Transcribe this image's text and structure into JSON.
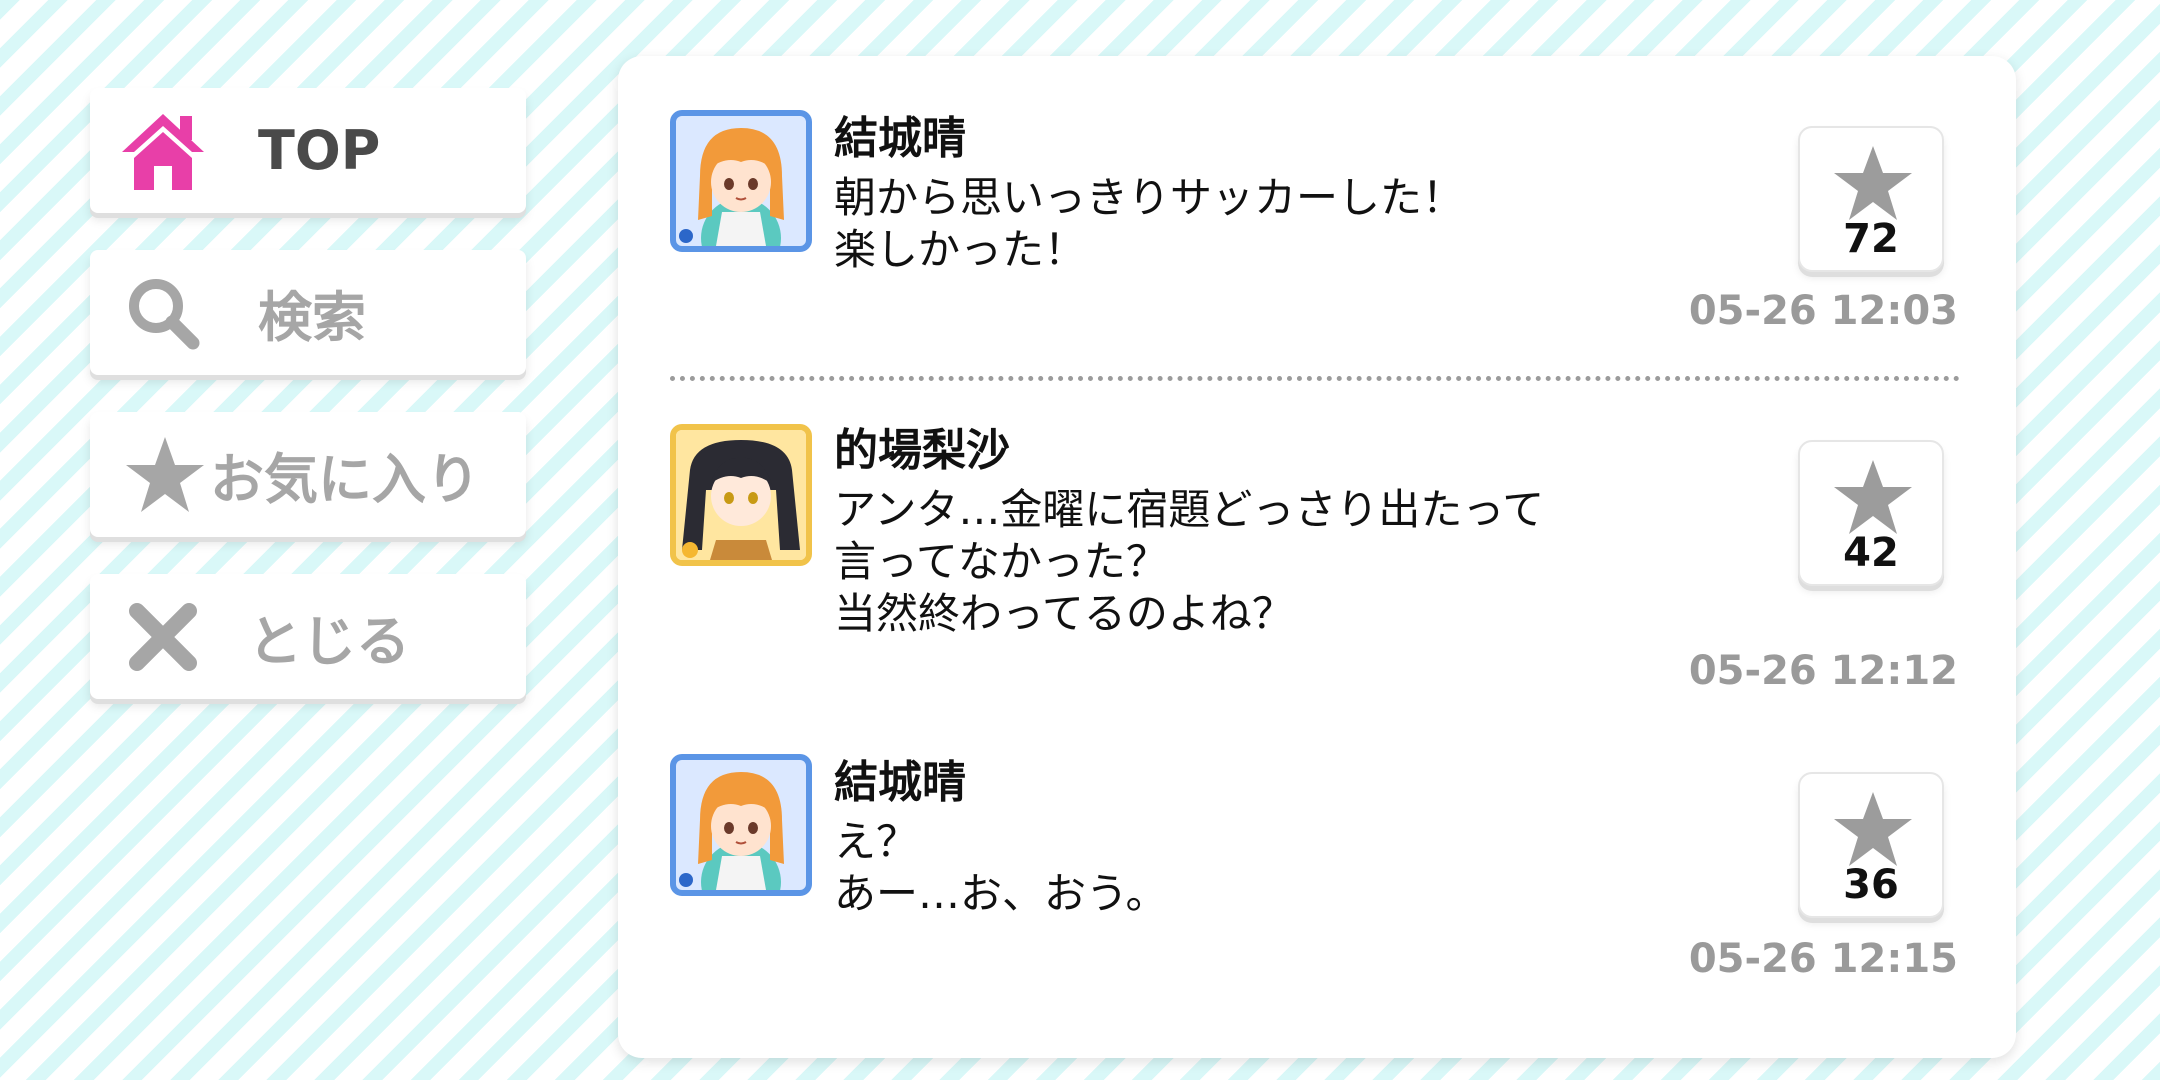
{
  "nav": {
    "top": {
      "label": "TOP",
      "icon": "home-icon",
      "color": "#e83fa8"
    },
    "search": {
      "label": "検索",
      "icon": "search-icon"
    },
    "favorites": {
      "label": "お気に入り",
      "icon": "star-icon"
    },
    "close": {
      "label": "とじる",
      "icon": "close-icon"
    }
  },
  "posts": [
    {
      "name": "結城晴",
      "lines": [
        "朝から思いっきりサッカーした！",
        "楽しかった！"
      ],
      "likes": "72",
      "time": "05-26 12:03",
      "avatar": "avatar-blue-frame"
    },
    {
      "name": "的場梨沙",
      "lines": [
        "アンタ…金曜に宿題どっさり出たって",
        "言ってなかった？",
        "当然終わってるのよね？"
      ],
      "likes": "42",
      "time": "05-26 12:12",
      "avatar": "avatar-gold-frame"
    },
    {
      "name": "結城晴",
      "lines": [
        "え？",
        "あー…お、おう。"
      ],
      "likes": "36",
      "time": "05-26 12:15",
      "avatar": "avatar-blue-frame"
    }
  ],
  "colors": {
    "accent_pink": "#e83fa8",
    "stripe": "#d9f8f8",
    "muted_gray": "#9a9a9a"
  }
}
